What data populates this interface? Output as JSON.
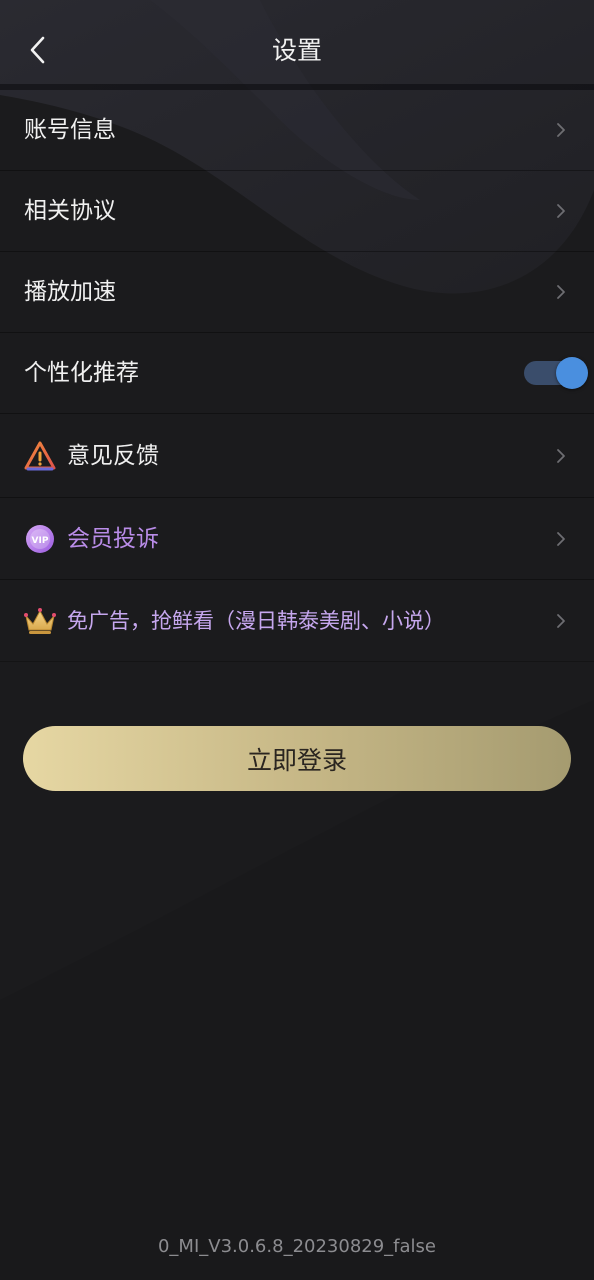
{
  "header": {
    "title": "设置",
    "back_icon": "back-arrow-icon"
  },
  "settings": {
    "account": "账号信息",
    "agreements": "相关协议",
    "playback_speed": "播放加速",
    "personalized": "个性化推荐",
    "personalized_enabled": true,
    "feedback": "意见反馈",
    "complaint": "会员投诉",
    "promo": "免广告，抢鲜看（漫日韩泰美剧、小说）"
  },
  "login_button": "立即登录",
  "version": "0_MI_V3.0.6.8_20230829_false",
  "colors": {
    "background": "#1b1b1d",
    "toggle_on": "#4a8fdf",
    "purple_text": "#b98ce8",
    "login_gradient_start": "#e6d7a3",
    "login_gradient_end": "#a59b70"
  }
}
